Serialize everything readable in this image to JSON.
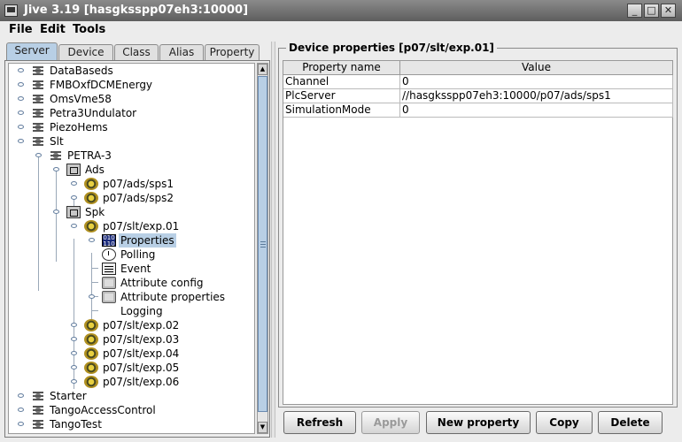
{
  "window": {
    "title": "Jive 3.19  [hasgksspp07eh3:10000]"
  },
  "menu": [
    "File",
    "Edit",
    "Tools"
  ],
  "tabs": [
    "Server",
    "Device",
    "Class",
    "Alias",
    "Property"
  ],
  "tree": {
    "servers": [
      "DataBaseds",
      "FMBOxfDCMEnergy",
      "OmsVme58",
      "Petra3Undulator",
      "PiezoHems",
      "Slt"
    ],
    "petra": "PETRA-3",
    "ads": "Ads",
    "ads_devices": [
      "p07/ads/sps1",
      "p07/ads/sps2"
    ],
    "spk": "Spk",
    "selected_device": "p07/slt/exp.01",
    "device_children": [
      "Properties",
      "Polling",
      "Event",
      "Attribute config",
      "Attribute properties",
      "Logging"
    ],
    "other_devices": [
      "p07/slt/exp.02",
      "p07/slt/exp.03",
      "p07/slt/exp.04",
      "p07/slt/exp.05",
      "p07/slt/exp.06"
    ],
    "bottom_servers": [
      "Starter",
      "TangoAccessControl",
      "TangoTest"
    ]
  },
  "details": {
    "title": "Device properties [p07/slt/exp.01]",
    "columns": [
      "Property name",
      "Value"
    ],
    "rows": [
      {
        "name": "Channel",
        "value": "0"
      },
      {
        "name": "PlcServer",
        "value": "//hasgksspp07eh3:10000/p07/ads/sps1"
      },
      {
        "name": "SimulationMode",
        "value": "0"
      }
    ]
  },
  "buttons": {
    "refresh": "Refresh",
    "apply": "Apply",
    "new_property": "New property",
    "copy": "Copy",
    "delete": "Delete"
  }
}
